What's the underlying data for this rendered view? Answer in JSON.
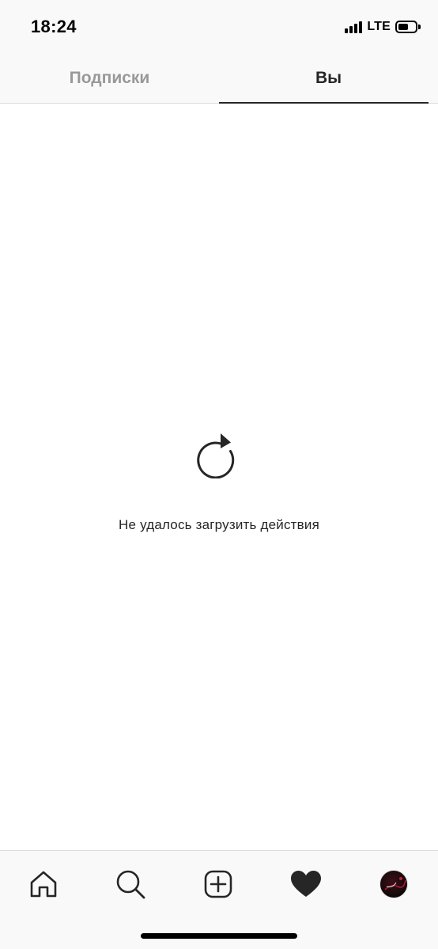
{
  "status_bar": {
    "time": "18:24",
    "network": "LTE",
    "signal_bars": 4,
    "battery_level_percent": 62
  },
  "tabs": [
    {
      "label": "Подписки",
      "active": false
    },
    {
      "label": "Вы",
      "active": true
    }
  ],
  "main": {
    "retry_icon": "refresh-icon",
    "error_message": "Не удалось загрузить действия"
  },
  "bottom_nav": {
    "items": [
      {
        "icon": "home-icon"
      },
      {
        "icon": "search-icon"
      },
      {
        "icon": "add-post-icon"
      },
      {
        "icon": "heart-icon",
        "active": true
      },
      {
        "icon": "profile-avatar"
      }
    ]
  },
  "colors": {
    "text": "#262626",
    "inactive_tab": "#999999",
    "bar_background": "#f9f9f9",
    "divider": "#dbdbdb"
  }
}
